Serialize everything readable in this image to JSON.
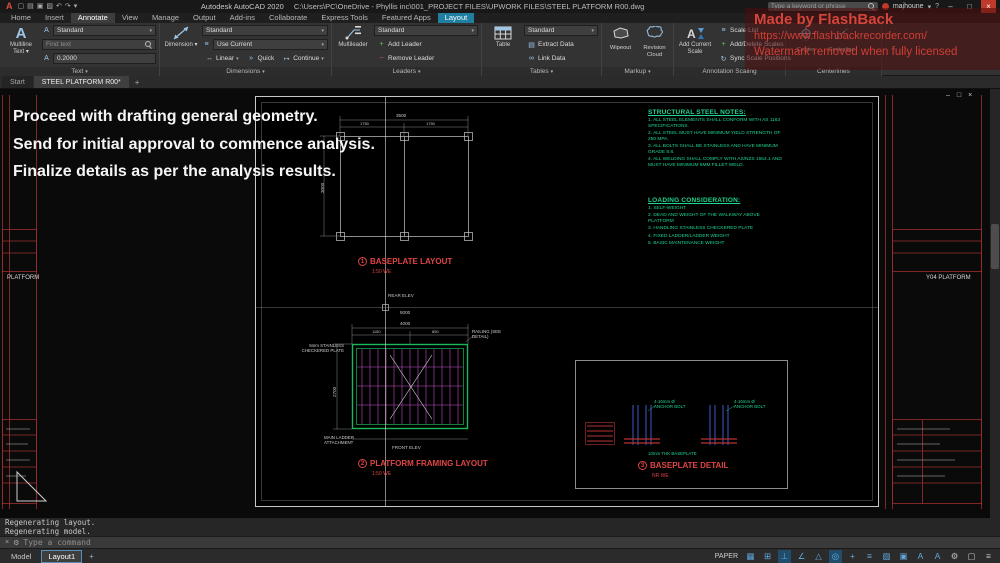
{
  "icons": {
    "autocad_logo": "A",
    "chevron_down": "▾",
    "new": "▢",
    "open": "▤",
    "save": "▣",
    "plot": "▨",
    "undo": "↶",
    "redo": "↷",
    "minimize": "–",
    "maximize": "□",
    "close": "×",
    "help": "?",
    "viewport_min": "–",
    "viewport_max": "□",
    "viewport_close": "×",
    "add": "+",
    "remove": "−",
    "text_style_big": "A",
    "annotative": "A",
    "dim_mini": "↔",
    "layer_mini": "≡",
    "quick_mini": "»",
    "continue_mini": "↦",
    "extract_mini": "▤",
    "link_mini": "∞",
    "scale_list_mini": "≡",
    "scale_add_mini": "+",
    "scale_sync_mini": "↻",
    "cmd_close": "×",
    "cmd_wrench": "⚙",
    "grid": "▦",
    "snap": "⊞",
    "ortho": "⊥",
    "polar": "∠",
    "iso": "△",
    "osnap": "◎",
    "otrack": "+",
    "lineweight": "≡",
    "transparency": "▨",
    "selection": "▣",
    "annotation_vis": "A",
    "autoscale": "A",
    "gear": "⚙",
    "clean": "▢",
    "customize": "≡"
  },
  "watermark": {
    "title": "Made by FlashBack",
    "url": "https://www.flashbackrecorder.com/",
    "note": "Watermark removed when fully licensed"
  },
  "titlebar": {
    "app_title": "Autodesk AutoCAD 2020",
    "file_path": "C:\\Users\\PC\\OneDrive - Phyllis inc\\001_PROJECT FILES\\UPWORK FILES\\STEEL PLATFORM R00.dwg",
    "search_placeholder": "Type a keyword or phrase",
    "username": "majhoune"
  },
  "ribbon": {
    "tabs": [
      "Home",
      "Insert",
      "Annotate",
      "View",
      "Manage",
      "Output",
      "Add-ins",
      "Collaborate",
      "Express Tools",
      "Featured Apps",
      "Layout"
    ],
    "text_panel": {
      "big_label_1": "Multiline",
      "big_label_2": "Text",
      "style_value": "Standard",
      "find_placeholder": "Find text",
      "text_height": "0.2000",
      "footer": "Text"
    },
    "dimension_panel": {
      "big_label": "Dimension",
      "style_value": "Standard",
      "layer_value": "Use Current",
      "linear": "Linear",
      "quick": "Quick",
      "continue": "Continue",
      "footer": "Dimensions"
    },
    "leaders_panel": {
      "big_label": "Multileader",
      "style_value": "Standard",
      "add_leader": "Add Leader",
      "remove_leader": "Remove Leader",
      "footer": "Leaders"
    },
    "tables_panel": {
      "big_label": "Table",
      "style_value": "Standard",
      "extract": "Extract Data",
      "link": "Link Data",
      "footer": "Tables"
    },
    "markup_panel": {
      "wipeout": "Wipeout",
      "revision_cloud": "Revision Cloud",
      "footer": "Markup"
    },
    "scaling_panel": {
      "big_label": "Add Current Scale",
      "scale_list": "Scale List",
      "add_delete": "Add/Delete Scales",
      "sync": "Sync Scale Positions",
      "footer": "Annotation Scaling"
    },
    "centerlines_panel": {
      "center": "Center",
      "centerline": "Centerline",
      "footer": "Centerlines"
    }
  },
  "filetabs": {
    "start": "Start",
    "drawing": "STEEL PLATFORM R00*",
    "new_tab": "+"
  },
  "canvas": {
    "overlay_lines": [
      "Proceed with drafting general geometry.",
      "Send for initial approval to commence analysis.",
      "Finalize details as per the analysis results."
    ],
    "left_sheet_label": "PLATFORM",
    "right_sheet_label": "Y04  PLATFORM",
    "labels": {
      "baseplate_layout": {
        "num": "1",
        "title": "BASEPLATE LAYOUT",
        "scale": "1:50  WE"
      },
      "framing_layout": {
        "num": "2",
        "title": "PLATFORM FRAMING LAYOUT",
        "scale": "1:50  WE"
      },
      "baseplate_detail": {
        "num": "3",
        "title": "BASEPLATE DETAIL",
        "scale": "NR  WE"
      }
    },
    "dims": {
      "d3500": "3500",
      "d1750a": "1750",
      "d1750b": "1750",
      "d3000": "3000",
      "d4000": "4000",
      "d1150": "1150",
      "d850": "850",
      "d2700": "2700",
      "d5000": "5000"
    },
    "rear_elev": "REAR ELEV",
    "front_elev": "FRONT ELEV",
    "annotations": {
      "checkered_plate": "5mm STAINLESS CHECKERED PLATE",
      "ladder": "MAIN LADDER ATTACHMENT",
      "railing": "RAILING (SEE DETAIL)",
      "anchor_bolt_1": "4-16mm Ø ANCHOR BOLT",
      "anchor_bolt_2": "4-16mm Ø ANCHOR BOLT",
      "baseplate_thk": "10mm THK BASEPLATE"
    },
    "steel_notes": {
      "title": "STRUCTURAL STEEL NOTES:",
      "items": [
        "1.  ALL STEEL ELEMENTS SHALL CONFORM WITH AS 1163 SPECIFICATIONS.",
        "2.  ALL STEEL MUST HAVE MINIMUM YIELD STRENGTH OF 250 MPA.",
        "3.  ALL BOLTS SHALL BE STAINLESS AND HAVE MINIMUM GRADE 8.8.",
        "4.  ALL WELDING SHALL COMPLY WITH AS/NZS 1554.1 AND MUST HAVE MINIMUM 6MM FILLET WELD."
      ]
    },
    "loading_notes": {
      "title": "LOADING CONSIDERATION:",
      "items": [
        "1.  SELF-WEIGHT",
        "2.  DEAD AND WEIGHT OF THE WALKWAY ABOVE PLATFORM",
        "3.  HANDLING STAINLESS CHECKERED PLATE",
        "4.  FIXED LADDER/LADDER WEIGHT",
        "5.  BASIC MAINTENANCE WEIGHT"
      ]
    }
  },
  "commandline": {
    "history": [
      "Regenerating layout.",
      "Regenerating model."
    ],
    "prompt": "Type a command"
  },
  "statusbar": {
    "model_tab": "Model",
    "layout_tab": "Layout1",
    "new_layout_btn": "+",
    "space_label": "PAPER"
  }
}
